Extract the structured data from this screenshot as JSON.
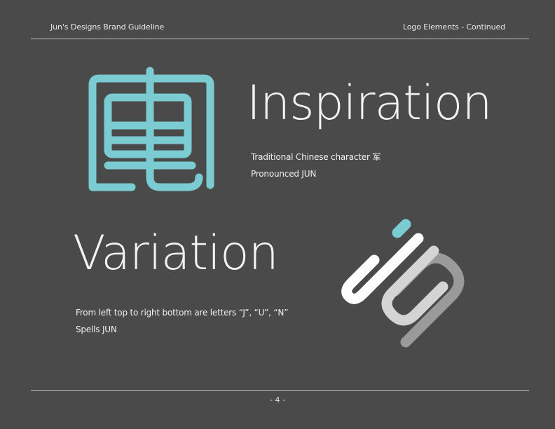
{
  "header": {
    "left": "Jun's Designs Brand Guideline",
    "right": "Logo Elements - Continued"
  },
  "inspiration": {
    "title": "Inspiration",
    "lines": [
      "Traditional Chinese character 军",
      "Pronounced JUN"
    ]
  },
  "variation": {
    "title": "Variation",
    "lines": [
      "From left top to right bottom are letters “J”, “U”, “N”",
      "Spells JUN"
    ]
  },
  "footer": {
    "page_number": "- 4 -"
  },
  "icons": {
    "character_logo": "jun-character-icon",
    "letter_logo": "jun-letters-icon"
  },
  "colors": {
    "background": "#4a4a4b",
    "teal": "#7accd2",
    "white": "#ffffff",
    "light_gray": "#d4d4d4",
    "mid_gray": "#9a9a9a"
  }
}
